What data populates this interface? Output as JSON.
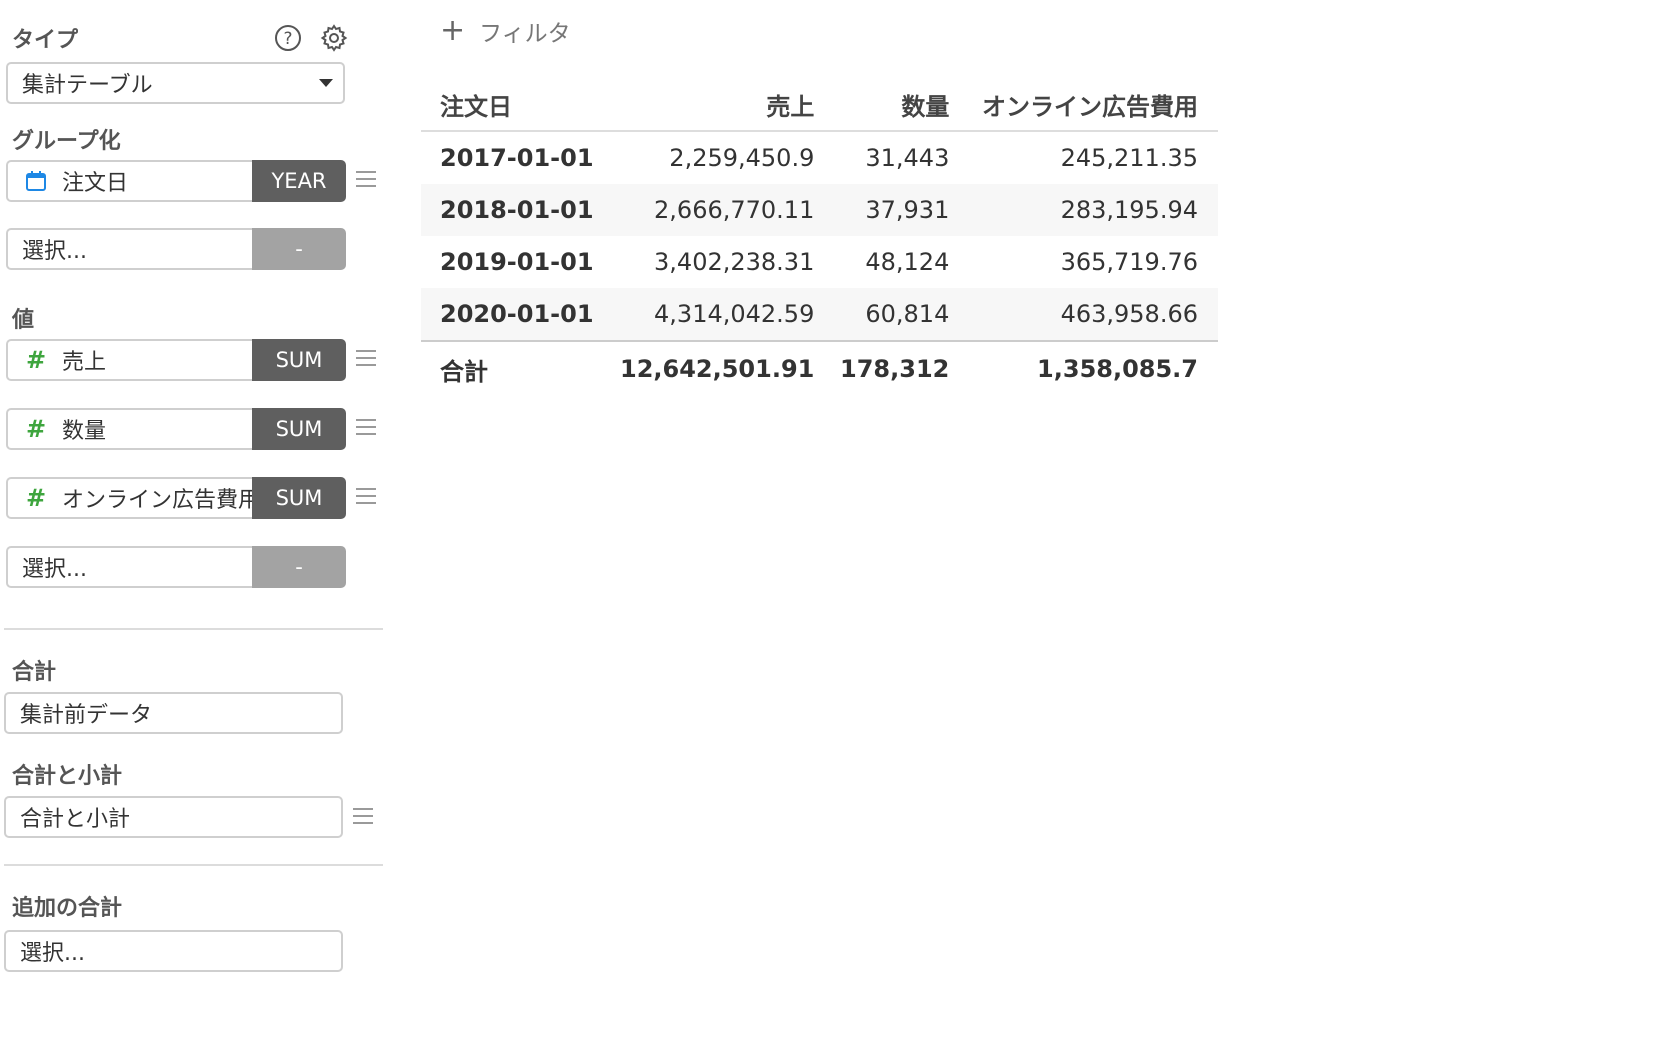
{
  "sidebar": {
    "type": {
      "label": "タイプ",
      "value": "集計テーブル",
      "help_icon": "help-circle-icon",
      "settings_icon": "gear-icon"
    },
    "grouping": {
      "label": "グループ化",
      "fields": [
        {
          "name": "注文日",
          "icon": "calendar-icon",
          "agg": "YEAR"
        }
      ],
      "empty_select": {
        "placeholder": "選択...",
        "agg": "-"
      }
    },
    "values": {
      "label": "値",
      "fields": [
        {
          "name": "売上",
          "icon": "#",
          "agg": "SUM"
        },
        {
          "name": "数量",
          "icon": "#",
          "agg": "SUM"
        },
        {
          "name": "オンライン広告費用",
          "icon": "#",
          "agg": "SUM"
        }
      ],
      "empty_select": {
        "placeholder": "選択...",
        "agg": "-"
      }
    },
    "total": {
      "label": "合計",
      "value": "集計前データ"
    },
    "total_subtotal": {
      "label": "合計と小計",
      "value": "合計と小計"
    },
    "additional_total": {
      "label": "追加の合計",
      "placeholder": "選択..."
    }
  },
  "main": {
    "filter_add": {
      "icon": "+",
      "label": "フィルタ"
    },
    "table": {
      "headers": [
        "注文日",
        "売上",
        "数量",
        "オンライン広告費用"
      ],
      "rows": [
        [
          "2017-01-01",
          "2,259,450.9",
          "31,443",
          "245,211.35"
        ],
        [
          "2018-01-01",
          "2,666,770.11",
          "37,931",
          "283,195.94"
        ],
        [
          "2019-01-01",
          "3,402,238.31",
          "48,124",
          "365,719.76"
        ],
        [
          "2020-01-01",
          "4,314,042.59",
          "60,814",
          "463,958.66"
        ]
      ],
      "total": [
        "合計",
        "12,642,501.91",
        "178,312",
        "1,358,085.7"
      ]
    }
  },
  "colors": {
    "agg_button": "#5f5f5f",
    "agg_button_disabled": "#a3a3a3",
    "numeric_icon": "#3ea53e",
    "date_icon": "#1e88e5"
  }
}
